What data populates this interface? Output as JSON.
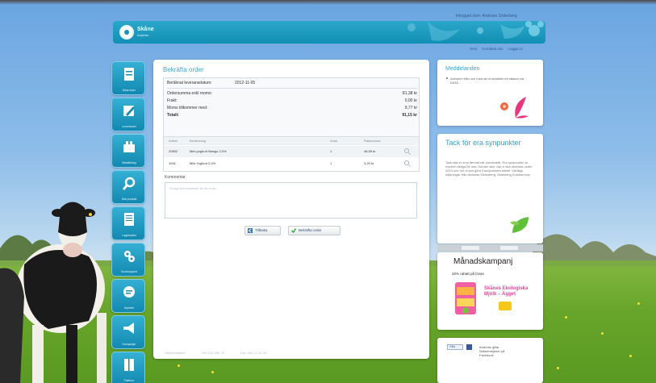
{
  "user_line": "Inloggad som: Andreas Söderberg",
  "header": {
    "brand": "Skåne",
    "brand_sub": "mejerier"
  },
  "top_links": [
    "Hem",
    "Kontakta oss",
    "Logga ut"
  ],
  "leftnav": [
    {
      "label": "Mina sidor",
      "icon": "document-icon"
    },
    {
      "label": "Leveranser",
      "icon": "pencil-icon"
    },
    {
      "label": "Beställning",
      "icon": "tools-icon"
    },
    {
      "label": "Sök produkt",
      "icon": "search-icon"
    },
    {
      "label": "Lagersaldo",
      "icon": "list-icon"
    },
    {
      "label": "Kundsupport",
      "icon": "gears-icon"
    },
    {
      "label": "Nyheter",
      "icon": "bubble-icon"
    },
    {
      "label": "Kampanjer",
      "icon": "megaphone-icon"
    },
    {
      "label": "Fakturor",
      "icon": "book-icon"
    }
  ],
  "main": {
    "title": "Bekräfta order",
    "delivery_label": "Beräknat leveransdatum:",
    "delivery_value": "2012-11-05",
    "summary": [
      {
        "label": "Ordersumma exkl moms:",
        "value": "81,38 kr"
      },
      {
        "label": "Frakt:",
        "value": "0,00 kr"
      },
      {
        "label": "Moms tillkommer med:",
        "value": "9,77 kr"
      },
      {
        "label": "Totalt:",
        "value": "91,15 kr"
      }
    ],
    "columns": [
      "Artikel",
      "Benämning",
      "Antal",
      "Radsumma"
    ],
    "items": [
      {
        "art": "20892",
        "name": "Mini-yoghurt Mango 2,0%",
        "qty": "1",
        "price": "48,99 kr"
      },
      {
        "art": "1091",
        "name": "Mild Yoghurt 2,0%",
        "qty": "1",
        "price": "3,29 kr"
      }
    ],
    "comment_label": "Kommentar",
    "comment_placeholder": "Övriga kommentarer till din order",
    "back_label": "Tillbaka",
    "confirm_label": "Bekräfta order",
    "footer": [
      "Skånemejerier",
      "040-123 456 78",
      "Fax: 040-12 34 56"
    ]
  },
  "sidebar": {
    "news_title": "Meddelanden",
    "news_text": "Avbryten från och med att ni beställer ett sådant via DATA",
    "tips_title": "Tack för era synpunkter",
    "tips_text": "Tack alla er som lämnat vår kundenkät. Era synpunkter är mycket viktiga för oss. Kunder ska, vad vi ska utveckla under 2013 och hur vi kan göra Kundportalen bättre. Vänliga hälsningar från Andreas Söderberg, Marketing Kundservice",
    "campaign_title": "Månadskampanj",
    "campaign_sub": "20% rabatt på lövan",
    "campaign_promo": "Skånes Ekologiska Mjölk – Ägget",
    "fb_like": "Gilla",
    "fb_text": "Andreas gillar Skånemejerier på Facebook"
  },
  "colors": {
    "accent": "#2aa7c9",
    "title": "#39a3c9",
    "confirm_icon": "#2fa33a"
  }
}
